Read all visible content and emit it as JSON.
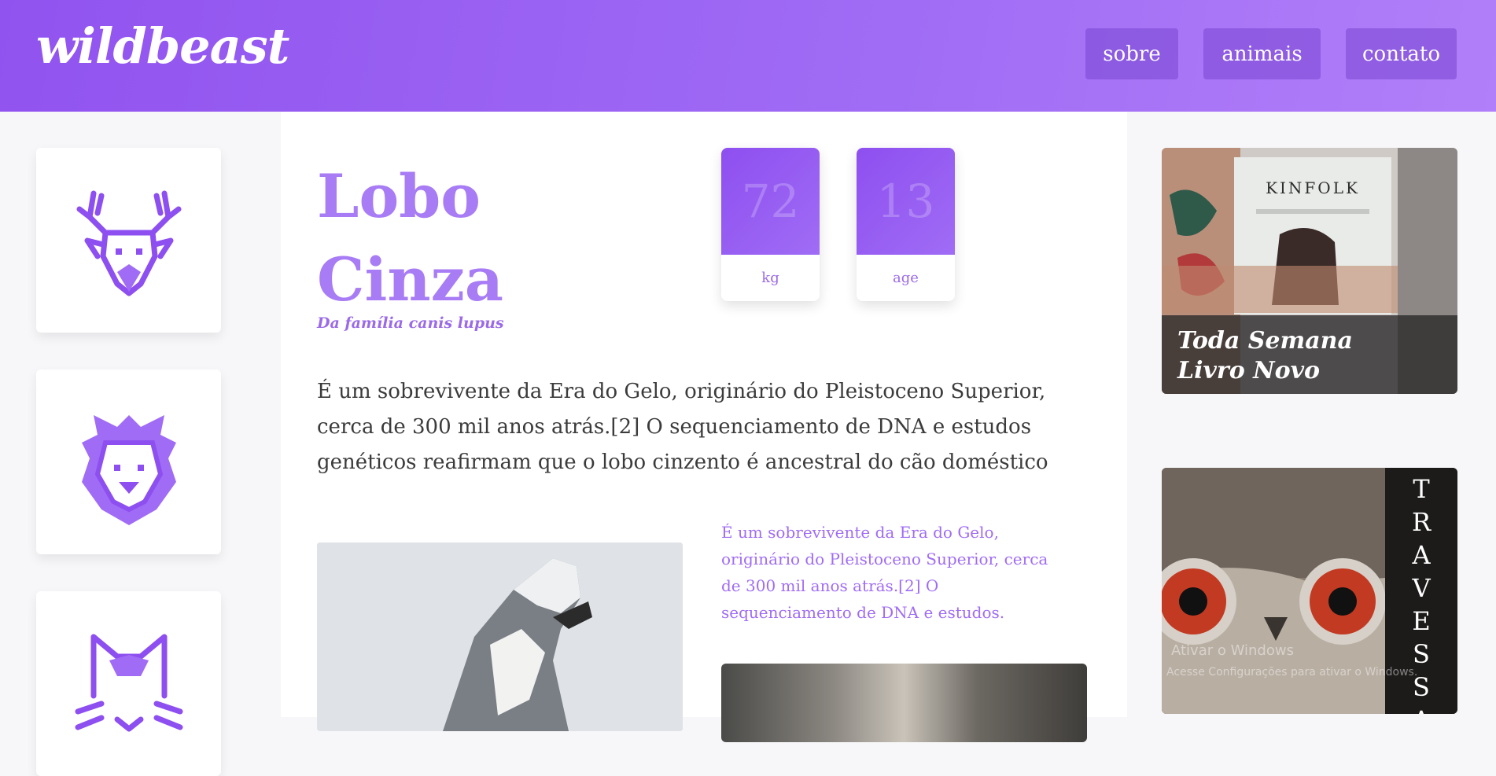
{
  "header": {
    "logo": "wildbeast",
    "nav": [
      {
        "label": "sobre"
      },
      {
        "label": "animais"
      },
      {
        "label": "contato"
      }
    ]
  },
  "sidebar": {
    "animals": [
      {
        "icon": "deer-icon"
      },
      {
        "icon": "lion-icon"
      },
      {
        "icon": "cat-icon"
      }
    ]
  },
  "animal": {
    "title_line1": "Lobo",
    "title_line2": "Cinza",
    "subtitle": "Da família canis lupus",
    "stats": [
      {
        "value": "72",
        "label": "kg"
      },
      {
        "value": "13",
        "label": "age"
      }
    ],
    "intro": "É um sobrevivente da Era do Gelo, originário do Pleistoceno Superior, cerca de 300 mil anos atrás.[2] O sequenciamento de DNA e estudos genéticos reafirmam que o lobo cinzento é ancestral do cão doméstico",
    "side_text": "É um sobrevivente da Era do Gelo, originário do Pleistoceno Superior, cerca de 300 mil anos atrás.[2] O sequenciamento de DNA e estudos."
  },
  "right": {
    "promo": {
      "magazine": "KINFOLK",
      "caption_line1": "Toda Semana",
      "caption_line2": "Livro Novo"
    },
    "ad": {
      "letters": [
        "T",
        "R",
        "A",
        "V",
        "E",
        "S",
        "S",
        "A"
      ],
      "watermark_line1": "Ativar o Windows",
      "watermark_line2": "Acesse Configurações para ativar o Windows."
    }
  },
  "colors": {
    "accent": "#a06cf5",
    "accent_dark": "#8e4ff0",
    "text": "#3b3b3b"
  }
}
